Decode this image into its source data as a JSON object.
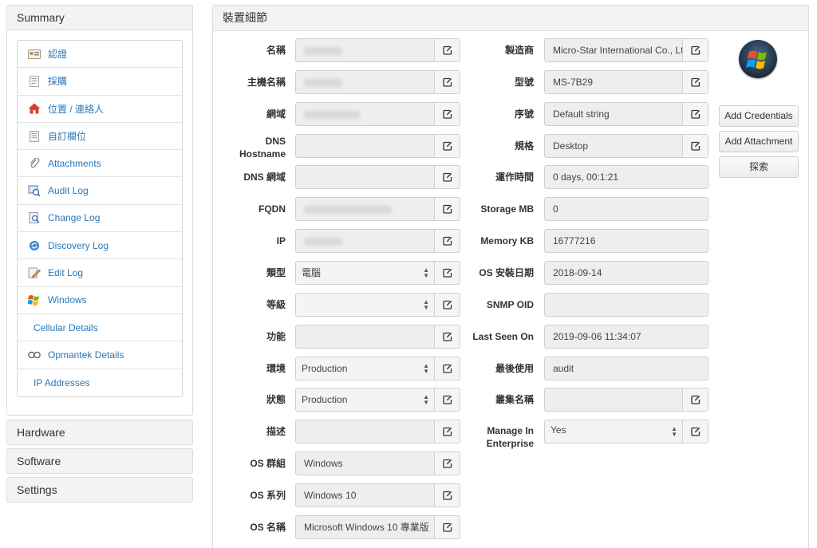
{
  "sidebar": {
    "summary_title": "Summary",
    "items": [
      {
        "label": "認證",
        "icon": "id-card-icon"
      },
      {
        "label": "採購",
        "icon": "receipt-icon"
      },
      {
        "label": "位置 / 連絡人",
        "icon": "home-icon"
      },
      {
        "label": "自訂欄位",
        "icon": "document-icon"
      },
      {
        "label": "Attachments",
        "icon": "paperclip-icon"
      },
      {
        "label": "Audit Log",
        "icon": "audit-icon"
      },
      {
        "label": "Change Log",
        "icon": "magnifier-doc-icon"
      },
      {
        "label": "Discovery Log",
        "icon": "refresh-icon"
      },
      {
        "label": "Edit Log",
        "icon": "pencil-doc-icon"
      },
      {
        "label": "Windows",
        "icon": "windows-icon"
      },
      {
        "label": "Cellular Details",
        "icon": ""
      },
      {
        "label": "Opmantek Details",
        "icon": "opmantek-icon"
      },
      {
        "label": "IP Addresses",
        "icon": ""
      }
    ],
    "sections": [
      "Hardware",
      "Software",
      "Settings"
    ]
  },
  "details": {
    "title": "裝置細節",
    "left_fields": [
      {
        "label": "名稱",
        "value": "",
        "blurred": true,
        "type": "text"
      },
      {
        "label": "主機名稱",
        "value": "",
        "blurred": true,
        "type": "text"
      },
      {
        "label": "網域",
        "value": "",
        "blurred": true,
        "type": "text"
      },
      {
        "label": "DNS Hostname",
        "value": "",
        "blurred": false,
        "type": "text"
      },
      {
        "label": "DNS 網域",
        "value": "",
        "blurred": false,
        "type": "text"
      },
      {
        "label": "FQDN",
        "value": "",
        "blurred": true,
        "type": "text"
      },
      {
        "label": "IP",
        "value": "",
        "blurred": true,
        "type": "text"
      },
      {
        "label": "類型",
        "value": "電腦",
        "blurred": false,
        "type": "select"
      },
      {
        "label": "等級",
        "value": "",
        "blurred": false,
        "type": "select"
      },
      {
        "label": "功能",
        "value": "",
        "blurred": false,
        "type": "text"
      },
      {
        "label": "環境",
        "value": "Production",
        "blurred": false,
        "type": "select"
      },
      {
        "label": "狀態",
        "value": "Production",
        "blurred": false,
        "type": "select"
      },
      {
        "label": "描述",
        "value": "",
        "blurred": false,
        "type": "text"
      },
      {
        "label": "OS 群組",
        "value": "Windows",
        "blurred": false,
        "type": "text"
      },
      {
        "label": "OS 系列",
        "value": "Windows 10",
        "blurred": false,
        "type": "text"
      },
      {
        "label": "OS 名稱",
        "value": "Microsoft Windows 10 專業版",
        "blurred": false,
        "type": "text"
      }
    ],
    "right_fields": [
      {
        "label": "製造商",
        "value": "Micro-Star International Co., Lt",
        "editable": true,
        "type": "text"
      },
      {
        "label": "型號",
        "value": "MS-7B29",
        "editable": true,
        "type": "text"
      },
      {
        "label": "序號",
        "value": "Default string",
        "editable": true,
        "type": "text"
      },
      {
        "label": "規格",
        "value": "Desktop",
        "editable": true,
        "type": "text"
      },
      {
        "label": "運作時間",
        "value": "0 days, 00:1:21",
        "editable": false,
        "type": "text"
      },
      {
        "label": "Storage MB",
        "value": "0",
        "editable": false,
        "type": "text"
      },
      {
        "label": "Memory KB",
        "value": "16777216",
        "editable": false,
        "type": "text"
      },
      {
        "label": "OS 安裝日期",
        "value": "2018-09-14",
        "editable": false,
        "type": "text"
      },
      {
        "label": "SNMP OID",
        "value": "",
        "editable": false,
        "type": "text"
      },
      {
        "label": "Last Seen On",
        "value": "2019-09-06 11:34:07",
        "editable": false,
        "type": "text"
      },
      {
        "label": "最後使用",
        "value": "audit",
        "editable": false,
        "type": "text"
      },
      {
        "label": "叢集名稱",
        "value": "",
        "editable": true,
        "type": "text"
      },
      {
        "label": "Manage In Enterprise",
        "value": "Yes",
        "editable": true,
        "type": "select"
      }
    ],
    "actions": {
      "add_credentials": "Add Credentials",
      "add_attachment": "Add Attachment",
      "discover": "探索"
    },
    "os_logo": "windows-logo-icon"
  }
}
